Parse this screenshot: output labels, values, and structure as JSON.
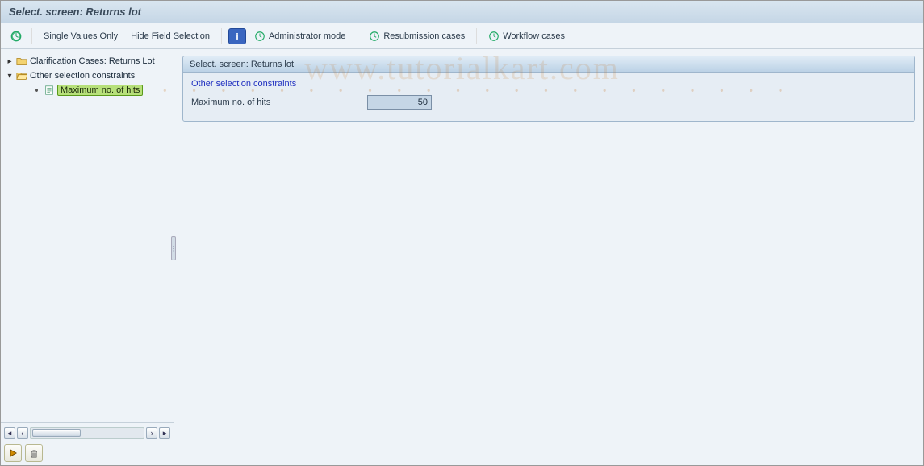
{
  "title": "Select. screen: Returns lot",
  "toolbar": {
    "execute_icon": "execute-icon",
    "single_values": "Single Values Only",
    "hide_field_selection": "Hide Field Selection",
    "info_icon": "info-icon",
    "admin_mode": "Administrator mode",
    "resubmission": "Resubmission cases",
    "workflow": "Workflow cases"
  },
  "tree": {
    "nodes": [
      {
        "label": "Clarification Cases: Returns Lot",
        "expanded": false,
        "icon": "folder-closed-icon"
      },
      {
        "label": "Other selection constraints",
        "expanded": true,
        "icon": "folder-open-icon",
        "children": [
          {
            "label": "Maximum no. of hits",
            "icon": "document-icon",
            "selected": true
          }
        ]
      }
    ],
    "actions": {
      "play": "play-icon",
      "delete": "trash-icon"
    }
  },
  "panel": {
    "header": "Select. screen: Returns lot",
    "group_title": "Other selection constraints",
    "fields": [
      {
        "label": "Maximum no. of hits",
        "value": "50"
      }
    ]
  },
  "watermark": {
    "main": "www.tutorialkart.com",
    "dots": "· · · · · · · · · · · · · · · · · · · · · · ·"
  }
}
